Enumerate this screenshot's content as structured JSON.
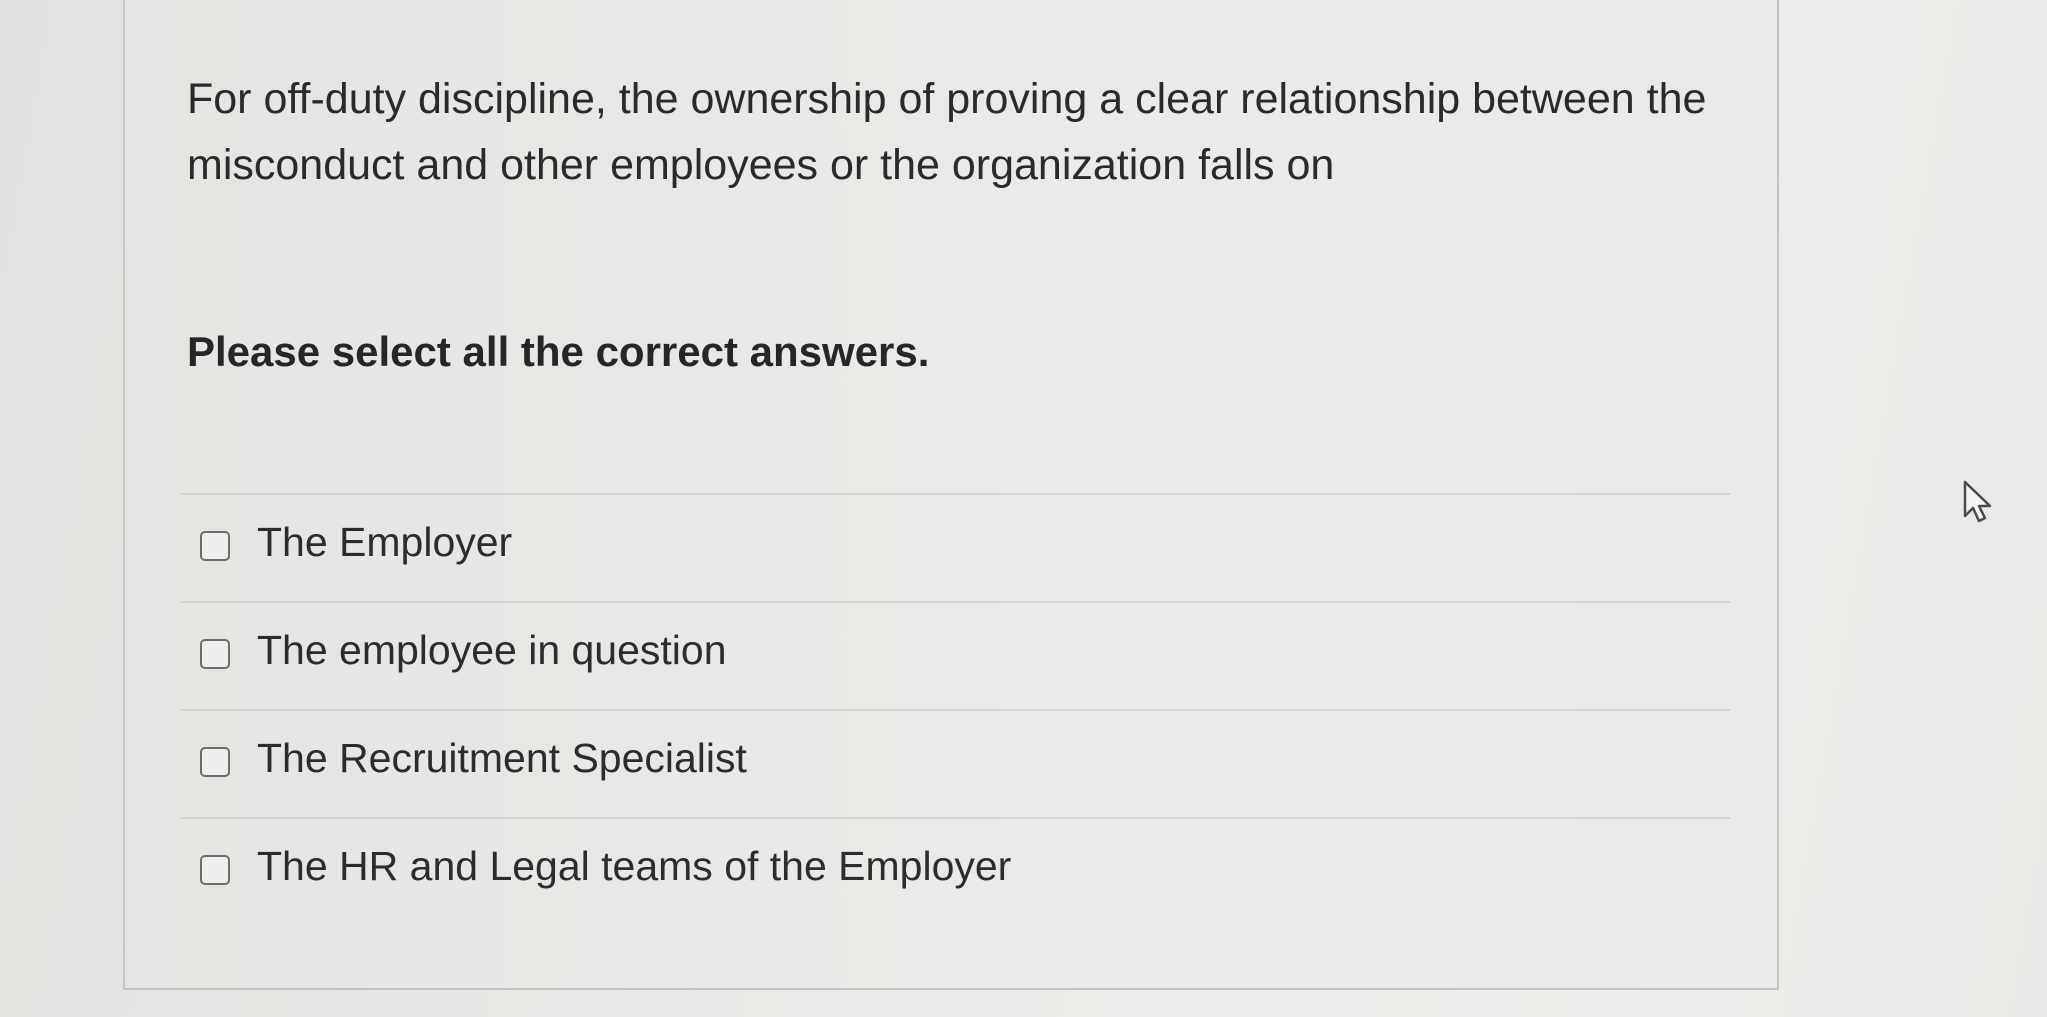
{
  "question": {
    "text": "For off-duty discipline, the ownership of proving a clear relationship between the misconduct and other employees or the organization falls on",
    "instruction": "Please select all the correct answers."
  },
  "options": [
    {
      "label": "The Employer",
      "checked": false
    },
    {
      "label": "The employee in question",
      "checked": false
    },
    {
      "label": "The Recruitment Specialist",
      "checked": false
    },
    {
      "label": "The HR and Legal teams of the Employer",
      "checked": false
    }
  ],
  "icons": {
    "checkbox": "checkbox-unchecked-icon",
    "cursor": "mouse-pointer-icon"
  }
}
